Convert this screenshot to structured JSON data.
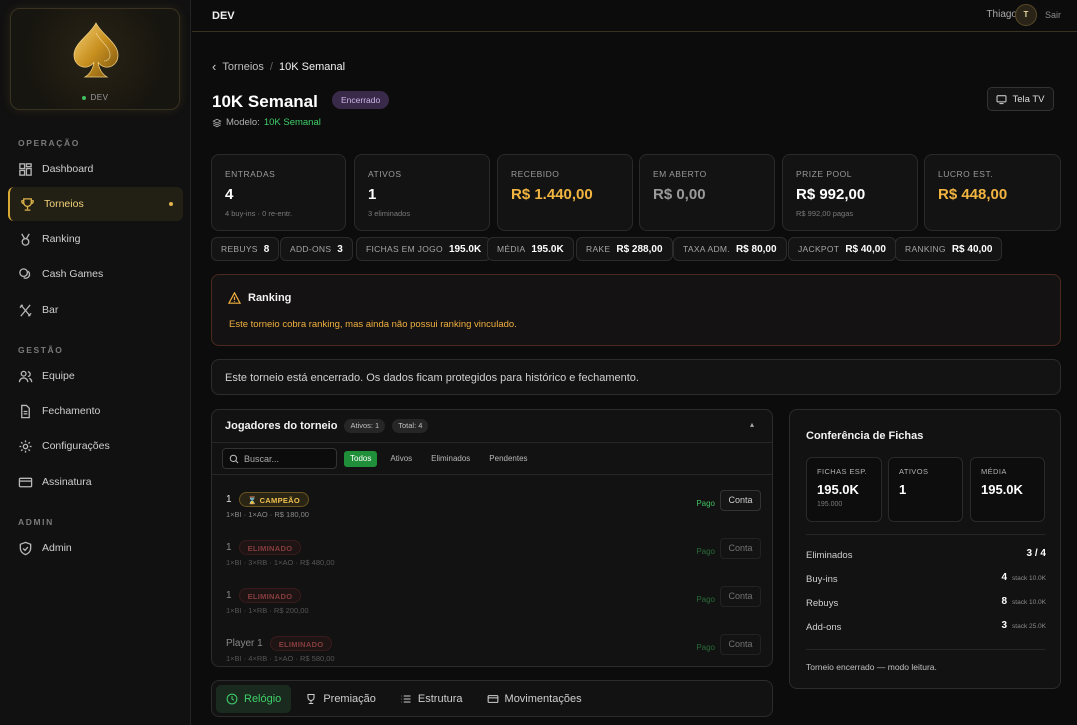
{
  "env": "DEV",
  "user": {
    "name": "Thiago",
    "initial": "T",
    "logout": "Sair"
  },
  "sidebar": {
    "sections": [
      "OPERAÇÃO",
      "GESTÃO",
      "ADMIN"
    ],
    "items": [
      {
        "label": "Dashboard",
        "icon": "grid-icon"
      },
      {
        "label": "Torneios",
        "icon": "trophy-icon",
        "active": true
      },
      {
        "label": "Ranking",
        "icon": "medal-icon"
      },
      {
        "label": "Cash Games",
        "icon": "coins-icon"
      },
      {
        "label": "Bar",
        "icon": "utensils-icon"
      },
      {
        "label": "Equipe",
        "icon": "users-icon"
      },
      {
        "label": "Fechamento",
        "icon": "file-icon"
      },
      {
        "label": "Configurações",
        "icon": "gear-icon"
      },
      {
        "label": "Assinatura",
        "icon": "card-icon"
      },
      {
        "label": "Admin",
        "icon": "shield-icon"
      }
    ]
  },
  "breadcrumb": {
    "parent": "Torneios",
    "sep": "/",
    "current": "10K Semanal"
  },
  "page": {
    "title": "10K Semanal",
    "status": "Encerrado",
    "model_label": "Modelo:",
    "model_value": "10K Semanal",
    "tv": "Tela TV"
  },
  "stats": [
    {
      "label": "ENTRADAS",
      "value": "4",
      "sub": "4 buy-ins · 0 re-entr."
    },
    {
      "label": "ATIVOS",
      "value": "1",
      "sub": "3 eliminados"
    },
    {
      "label": "RECEBIDO",
      "value": "R$ 1.440,00",
      "sub": ""
    },
    {
      "label": "EM ABERTO",
      "value": "R$ 0,00",
      "sub": ""
    },
    {
      "label": "PRIZE POOL",
      "value": "R$ 992,00",
      "sub": "R$ 992,00 pagas"
    },
    {
      "label": "LUCRO EST.",
      "value": "R$ 448,00",
      "sub": ""
    }
  ],
  "chips": [
    {
      "label": "REBUYS",
      "value": "8"
    },
    {
      "label": "ADD-ONS",
      "value": "3"
    },
    {
      "label": "FICHAS EM JOGO",
      "value": "195.0K"
    },
    {
      "label": "MÉDIA",
      "value": "195.0K"
    },
    {
      "label": "RAKE",
      "value": "R$ 288,00"
    },
    {
      "label": "TAXA ADM.",
      "value": "R$ 80,00"
    },
    {
      "label": "JACKPOT",
      "value": "R$ 40,00"
    },
    {
      "label": "RANKING",
      "value": "R$ 40,00"
    }
  ],
  "alert": {
    "title": "Ranking",
    "message": "Este torneio cobra ranking, mas ainda não possui ranking vinculado."
  },
  "info": "Este torneio está encerrado. Os dados ficam protegidos para histórico e fechamento.",
  "players": {
    "title": "Jogadores do torneio",
    "active_pill": "Ativos: 1",
    "total_pill": "Total: 4",
    "collapse": "▴",
    "search_placeholder": "Buscar...",
    "filters": [
      "Todos",
      "Ativos",
      "Eliminados",
      "Pendentes"
    ],
    "rows": [
      {
        "name": "1",
        "tag": "CAMPEÃO",
        "detail": "1×BI · 1×AO · R$ 180,00",
        "paid": "Pago",
        "action": "Conta"
      },
      {
        "name": "1",
        "tag": "ELIMINADO",
        "detail": "1×BI · 3×RB · 1×AO · R$ 480,00",
        "paid": "Pago",
        "action": "Conta"
      },
      {
        "name": "1",
        "tag": "ELIMINADO",
        "detail": "1×BI · 1×RB · R$ 200,00",
        "paid": "Pago",
        "action": "Conta"
      },
      {
        "name": "Player 1",
        "tag": "ELIMINADO",
        "detail": "1×BI · 4×RB · 1×AO · R$ 580,00",
        "paid": "Pago",
        "action": "Conta"
      }
    ]
  },
  "tabs": [
    {
      "label": "Relógio",
      "icon": "clock-icon"
    },
    {
      "label": "Premiação",
      "icon": "trophy-icon"
    },
    {
      "label": "Estrutura",
      "icon": "list-icon"
    },
    {
      "label": "Movimentações",
      "icon": "wallet-icon"
    }
  ],
  "conf": {
    "title": "Conferência de Fichas",
    "boxes": [
      {
        "label": "FICHAS ESP.",
        "value": "195.0K",
        "sub": "195.000"
      },
      {
        "label": "ATIVOS",
        "value": "1",
        "sub": ""
      },
      {
        "label": "MÉDIA",
        "value": "195.0K",
        "sub": ""
      }
    ],
    "rows": [
      {
        "label": "Eliminados",
        "value": "3 / 4",
        "note": ""
      },
      {
        "label": "Buy-ins",
        "value": "4",
        "note": "stack 10.0K"
      },
      {
        "label": "Rebuys",
        "value": "8",
        "note": "stack 10.0K"
      },
      {
        "label": "Add-ons",
        "value": "3",
        "note": "stack 25.0K"
      }
    ],
    "footer": "Torneio encerrado — modo leitura."
  },
  "colors": {
    "accent": "#e0b44a",
    "success": "#3fcf6a",
    "danger": "#e06060",
    "warning": "#f0b040"
  }
}
